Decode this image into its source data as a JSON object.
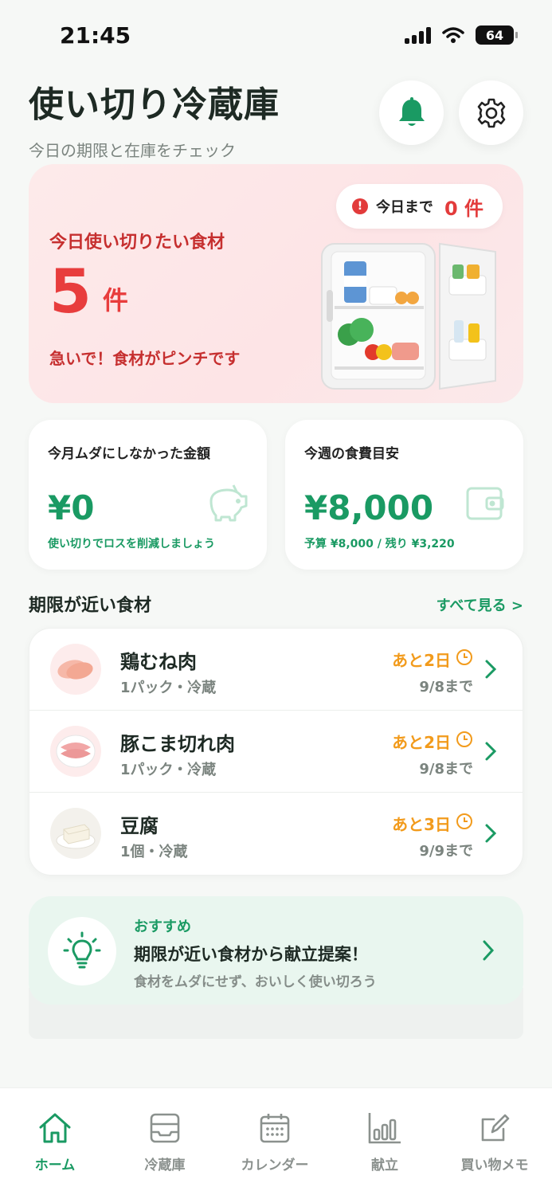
{
  "status_bar": {
    "time": "21:45",
    "battery": "64"
  },
  "header": {
    "title": "使い切り冷蔵庫",
    "subtitle": "今日の期限と在庫をチェック",
    "bell_icon": "bell-icon",
    "settings_icon": "gear-icon"
  },
  "hero": {
    "badge_label": "今日まで",
    "badge_count": "0 件",
    "title": "今日使い切りたい食材",
    "count": "5",
    "unit": "件",
    "note": "急いで！食材がピンチです",
    "illustration": "open-fridge"
  },
  "stats": {
    "saved": {
      "label": "今月ムダにしなかった金額",
      "value": "¥0",
      "note": "使い切りでロスを削減しましょう",
      "icon": "piggy-bank-icon"
    },
    "budget": {
      "label": "今週の食費目安",
      "value": "¥8,000",
      "note": "予算 ¥8,000 / 残り ¥3,220",
      "icon": "wallet-icon"
    }
  },
  "expiring": {
    "title": "期限が近い食材",
    "see_all": "すべて見る >",
    "items": [
      {
        "name": "鶏むね肉",
        "meta": "1パック・冷蔵",
        "days": "あと2日",
        "date": "9/8まで"
      },
      {
        "name": "豚こま切れ肉",
        "meta": "1パック・冷蔵",
        "days": "あと2日",
        "date": "9/8まで"
      },
      {
        "name": "豆腐",
        "meta": "1個・冷蔵",
        "days": "あと3日",
        "date": "9/9まで"
      }
    ]
  },
  "recommend": {
    "kicker": "おすすめ",
    "title": "期限が近い食材から献立提案！",
    "desc": "食材をムダにせず、おいしく使い切ろう",
    "icon": "lightbulb-icon"
  },
  "tabs": [
    {
      "label": "ホーム",
      "icon": "home-icon",
      "active": true
    },
    {
      "label": "冷蔵庫",
      "icon": "fridge-icon",
      "active": false
    },
    {
      "label": "カレンダー",
      "icon": "calendar-icon",
      "active": false
    },
    {
      "label": "献立",
      "icon": "bar-chart-icon",
      "active": false
    },
    {
      "label": "買い物メモ",
      "icon": "memo-icon",
      "active": false
    }
  ],
  "colors": {
    "accent": "#1a9a63",
    "alert": "#e83d3d",
    "warning": "#f29b1c",
    "hero_bg": "#fde8e9"
  }
}
